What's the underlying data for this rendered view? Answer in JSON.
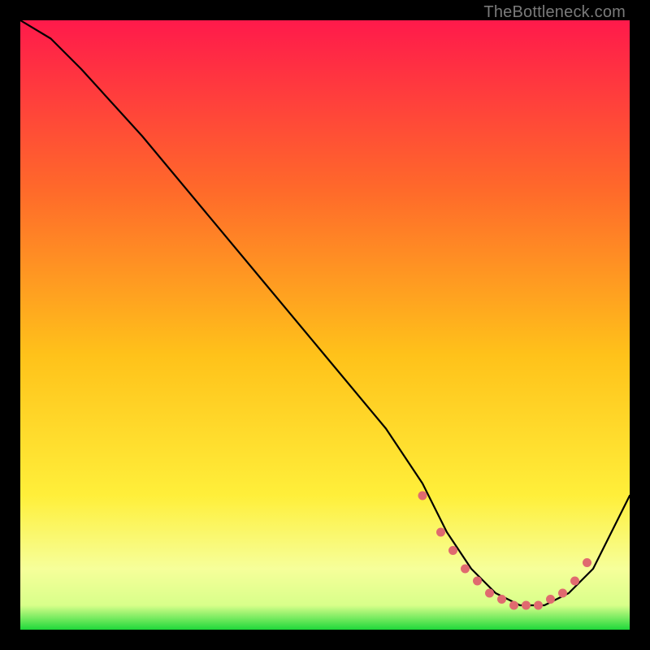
{
  "watermark": "TheBottleneck.com",
  "colors": {
    "bg": "#000000",
    "gradient_top": "#ff1a4b",
    "gradient_mid1": "#ff7a2a",
    "gradient_mid2": "#ffe21a",
    "gradient_band": "#f6ff9a",
    "gradient_bottom": "#1fd83a",
    "line": "#000000",
    "marker": "#e06a6f"
  },
  "chart_data": {
    "type": "line",
    "title": "",
    "xlabel": "",
    "ylabel": "",
    "xlim": [
      0,
      100
    ],
    "ylim": [
      0,
      100
    ],
    "series": [
      {
        "name": "curve",
        "x": [
          0,
          5,
          10,
          20,
          30,
          40,
          50,
          60,
          66,
          70,
          74,
          78,
          82,
          86,
          90,
          94,
          100
        ],
        "y": [
          100,
          97,
          92,
          81,
          69,
          57,
          45,
          33,
          24,
          16,
          10,
          6,
          4,
          4,
          6,
          10,
          22
        ]
      }
    ],
    "markers": {
      "name": "highlight",
      "x": [
        66,
        69,
        71,
        73,
        75,
        77,
        79,
        81,
        83,
        85,
        87,
        89,
        91,
        93
      ],
      "y": [
        22,
        16,
        13,
        10,
        8,
        6,
        5,
        4,
        4,
        4,
        5,
        6,
        8,
        11
      ]
    }
  }
}
